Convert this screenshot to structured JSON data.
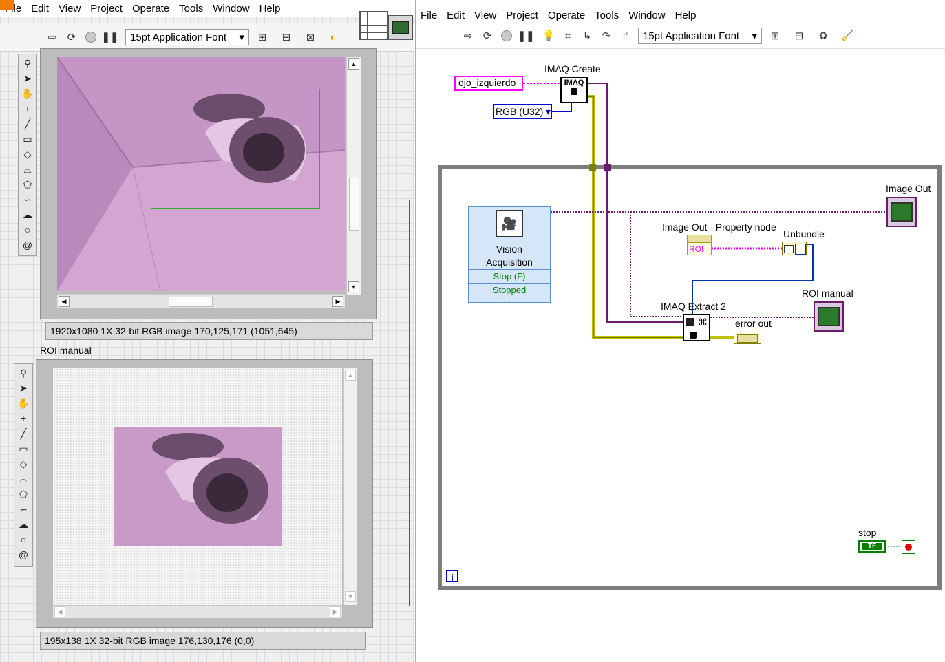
{
  "menus": [
    "File",
    "Edit",
    "View",
    "Project",
    "Operate",
    "Tools",
    "Window",
    "Help"
  ],
  "toolbar": {
    "font_label": "15pt Application Font"
  },
  "front_panel": {
    "display1": {
      "status": "1920x1080 1X 32-bit RGB image 170,125,171     (1051,645)"
    },
    "display2": {
      "label": "ROI manual",
      "status": "195x138 1X 32-bit RGB image 176,130,176     (0,0)"
    }
  },
  "block_diagram": {
    "string_const": "ojo_izquierdo",
    "imaq_create_label": "IMAQ Create",
    "imaq_create_glyph": "IMAQ",
    "rgb_enum": "RGB (U32)",
    "vision_acq": {
      "line1": "Vision",
      "line2": "Acquisition",
      "row1": "Stop (F)",
      "row2": "Stopped"
    },
    "image_out_label": "Image Out",
    "property_node_label": "Image Out - Property node",
    "roi_prop": "ROI",
    "unbundle_label": "Unbundle",
    "imaq_extract_label": "IMAQ Extract 2",
    "error_out_label": "error out",
    "roi_manual_label": "ROI manual",
    "stop_label": "stop",
    "stop_tf": "TF",
    "loop_iter": "i"
  },
  "colors": {
    "image_purple": "#c99ac8",
    "string_pink": "#ff00ff",
    "enum_blue": "#0000cc",
    "bool_green": "#008000",
    "cluster_yellow": "#a0a000"
  }
}
